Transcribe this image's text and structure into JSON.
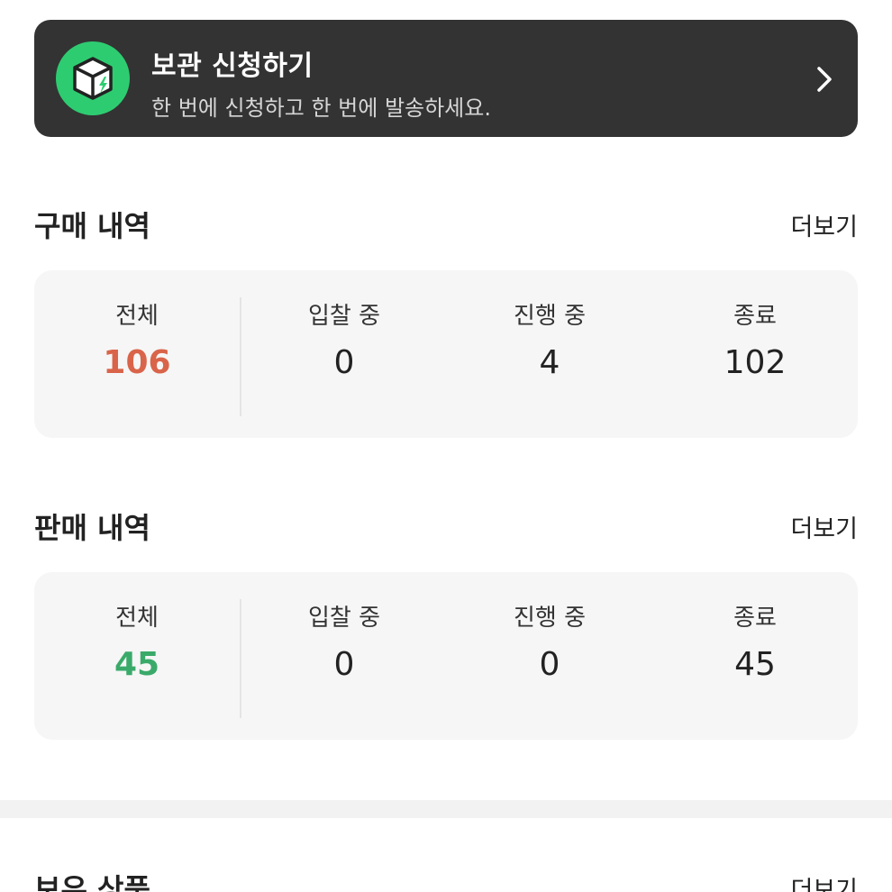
{
  "banner": {
    "title": "보관 신청하기",
    "subtitle": "한 번에 신청하고 한 번에 발송하세요.",
    "icon": "box-bolt-icon",
    "icon_color": "#2ecc71",
    "background": "#333333"
  },
  "purchase": {
    "title": "구매 내역",
    "more": "더보기",
    "stats": [
      {
        "label": "전체",
        "value": "106"
      },
      {
        "label": "입찰 중",
        "value": "0"
      },
      {
        "label": "진행 중",
        "value": "4"
      },
      {
        "label": "종료",
        "value": "102"
      }
    ],
    "accent_color": "#d9644a"
  },
  "sales": {
    "title": "판매 내역",
    "more": "더보기",
    "stats": [
      {
        "label": "전체",
        "value": "45"
      },
      {
        "label": "입찰 중",
        "value": "0"
      },
      {
        "label": "진행 중",
        "value": "0"
      },
      {
        "label": "종료",
        "value": "45"
      }
    ],
    "accent_color": "#3aaa6a"
  },
  "holdings": {
    "title": "보유 상품",
    "more": "더보기"
  }
}
